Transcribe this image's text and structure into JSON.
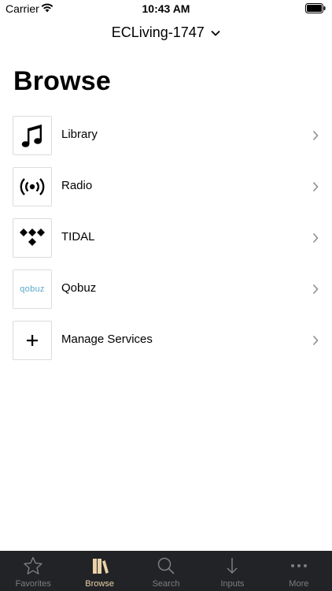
{
  "status_bar": {
    "carrier": "Carrier",
    "time": "10:43 AM"
  },
  "header": {
    "device_name": "ECLiving-1747",
    "title": "Browse"
  },
  "items": [
    {
      "label": "Library",
      "icon": "music-note-icon"
    },
    {
      "label": "Radio",
      "icon": "radio-broadcast-icon"
    },
    {
      "label": "TIDAL",
      "icon": "tidal-logo-icon"
    },
    {
      "label": "Qobuz",
      "icon": "qobuz-logo-icon",
      "logo_text": "qobuz"
    },
    {
      "label": "Manage Services",
      "icon": "plus-icon"
    }
  ],
  "tabs": [
    {
      "label": "Favorites",
      "icon": "star-icon",
      "active": false
    },
    {
      "label": "Browse",
      "icon": "books-icon",
      "active": true
    },
    {
      "label": "Search",
      "icon": "search-icon",
      "active": false
    },
    {
      "label": "Inputs",
      "icon": "arrow-down-icon",
      "active": false
    },
    {
      "label": "More",
      "icon": "ellipsis-icon",
      "active": false
    }
  ],
  "colors": {
    "tab_bar": "#222326",
    "tab_active": "#e9d2a7",
    "tab_inactive": "#7d7e82",
    "qobuz_logo": "#5aa9c9"
  }
}
